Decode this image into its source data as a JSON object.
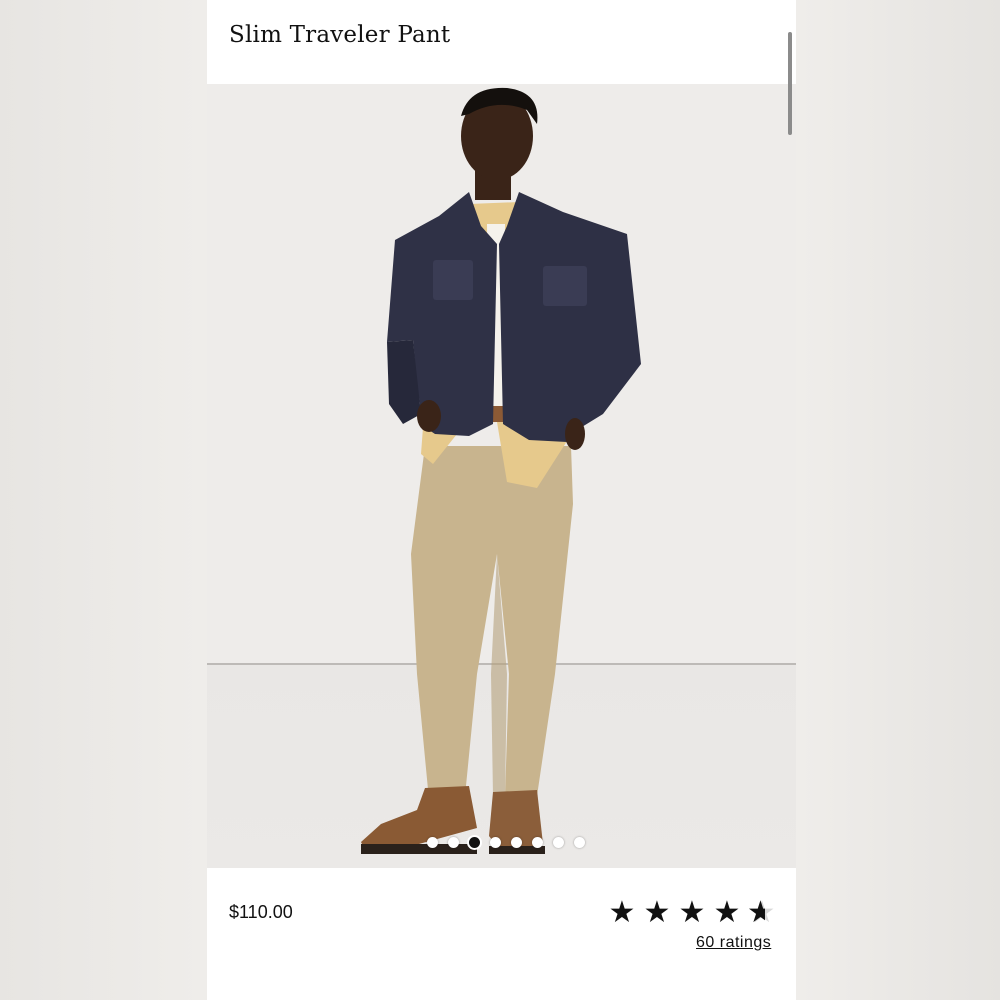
{
  "product": {
    "title": "Slim Traveler Pant",
    "price": "$110.00",
    "rating_value": 4.6,
    "rating_max": 5,
    "ratings_link": "60 ratings"
  },
  "gallery": {
    "image_count": 8,
    "active_index": 2,
    "image_description": "model wearing navy suede jacket, yellow check shirt, khaki pants and brown boots"
  },
  "icons": {
    "star": "★"
  },
  "colors": {
    "text": "#111111",
    "background": "#ffffff",
    "hero_background": "#eeecea"
  }
}
